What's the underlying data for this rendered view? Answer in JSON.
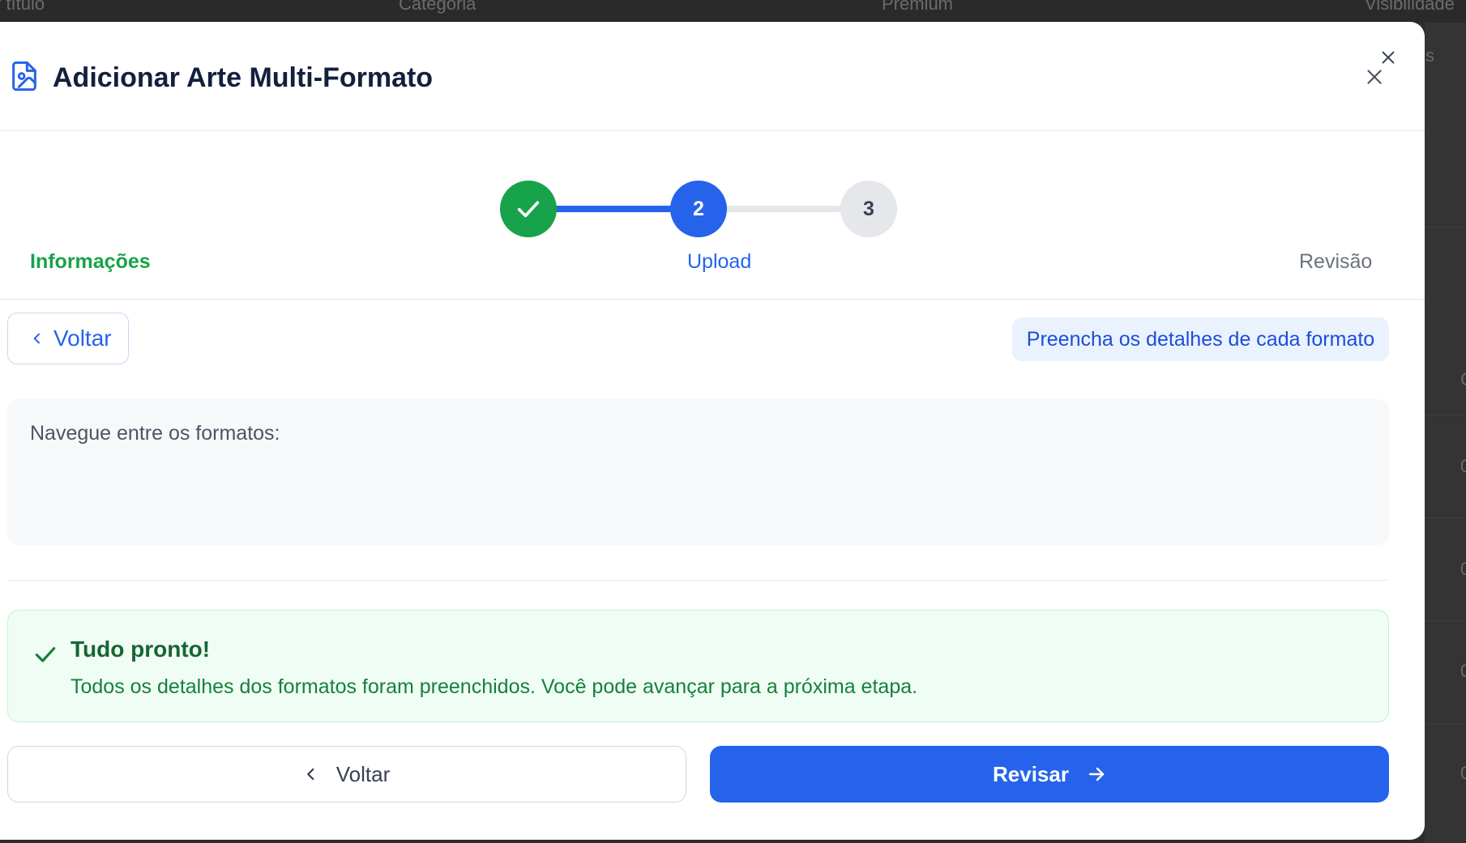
{
  "background": {
    "table_headers": [
      "r título",
      "Categoria",
      "Premium",
      "Visibilidade"
    ],
    "side_fragment": "s",
    "row_chars": [
      "C",
      "0",
      "0",
      "0",
      "0"
    ]
  },
  "modal": {
    "title": "Adicionar Arte Multi-Formato",
    "title_icon": "image-file-icon",
    "close_icon": "close-icon"
  },
  "stepper": {
    "steps": [
      {
        "number": "1",
        "label": "Informações",
        "status": "completed"
      },
      {
        "number": "2",
        "label": "Upload",
        "status": "current"
      },
      {
        "number": "3",
        "label": "Revisão",
        "status": "pending"
      }
    ]
  },
  "body": {
    "back_small_label": "Voltar",
    "hint": "Preencha os detalhes de cada formato",
    "nav_label": "Navegue entre os formatos:",
    "ready_title": "Tudo pronto!",
    "ready_text": "Todos os detalhes dos formatos foram preenchidos. Você pode avançar para a próxima etapa."
  },
  "footer": {
    "back_label": "Voltar",
    "review_label": "Revisar"
  },
  "colors": {
    "primary": "#2563eb",
    "success": "#16a34a",
    "pending": "#e5e7eb",
    "title": "#13203d"
  }
}
